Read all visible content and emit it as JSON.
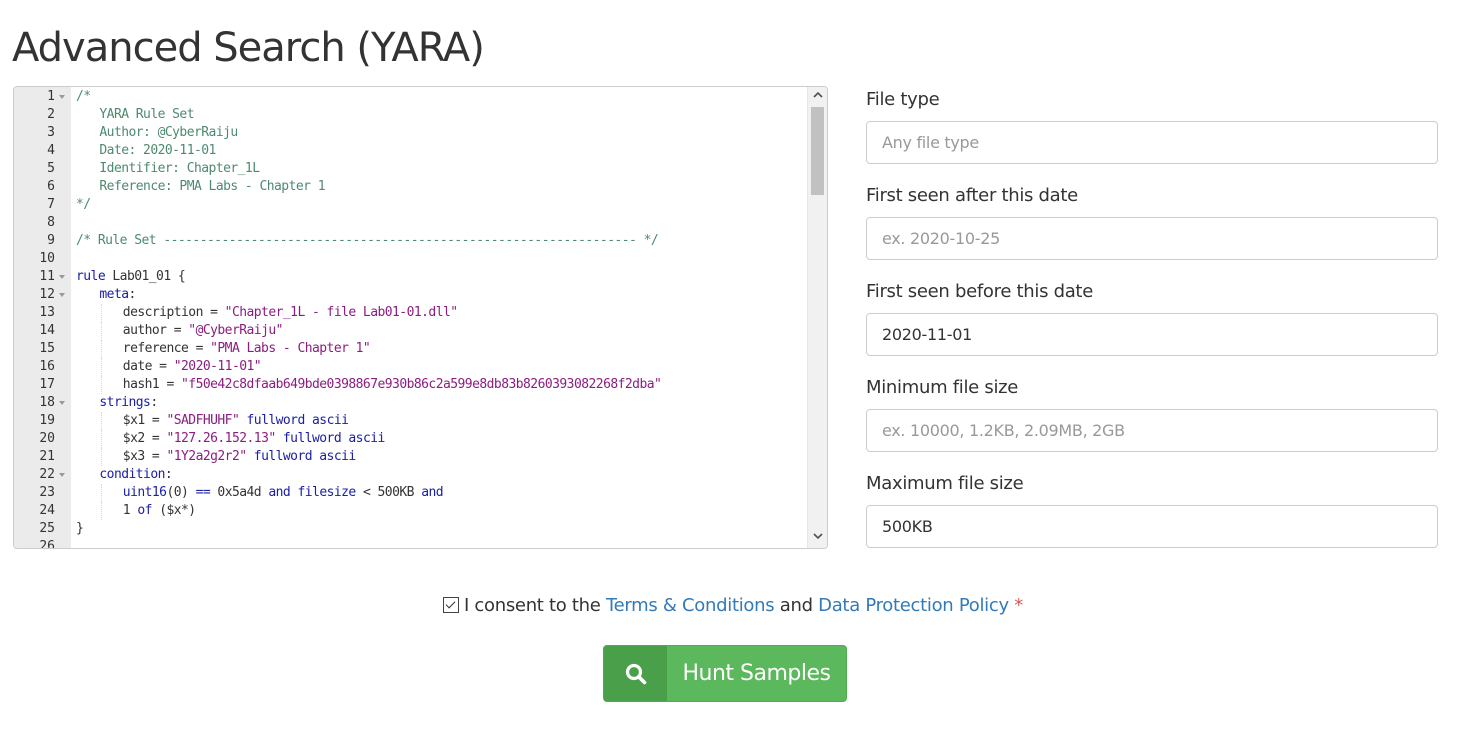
{
  "page": {
    "title": "Advanced Search (YARA)"
  },
  "editor": {
    "lines": [
      {
        "n": "1",
        "fold": true,
        "indent": 0,
        "tokens": [
          {
            "t": "/*",
            "c": "comment"
          }
        ]
      },
      {
        "n": "2",
        "fold": false,
        "indent": 1,
        "tokens": [
          {
            "t": "YARA Rule Set",
            "c": "comment"
          }
        ]
      },
      {
        "n": "3",
        "fold": false,
        "indent": 1,
        "tokens": [
          {
            "t": "Author: @CyberRaiju",
            "c": "comment"
          }
        ]
      },
      {
        "n": "4",
        "fold": false,
        "indent": 1,
        "tokens": [
          {
            "t": "Date: 2020-11-01",
            "c": "comment"
          }
        ]
      },
      {
        "n": "5",
        "fold": false,
        "indent": 1,
        "tokens": [
          {
            "t": "Identifier: Chapter_1L",
            "c": "comment"
          }
        ]
      },
      {
        "n": "6",
        "fold": false,
        "indent": 1,
        "tokens": [
          {
            "t": "Reference: PMA Labs - Chapter 1",
            "c": "comment"
          }
        ]
      },
      {
        "n": "7",
        "fold": false,
        "indent": 0,
        "tokens": [
          {
            "t": "*/",
            "c": "comment"
          }
        ]
      },
      {
        "n": "8",
        "fold": false,
        "indent": 0,
        "tokens": []
      },
      {
        "n": "9",
        "fold": false,
        "indent": 0,
        "tokens": [
          {
            "t": "/* Rule Set ----------------------------------------------------------------- */",
            "c": "comment"
          }
        ]
      },
      {
        "n": "10",
        "fold": false,
        "indent": 0,
        "tokens": []
      },
      {
        "n": "11",
        "fold": true,
        "indent": 0,
        "tokens": [
          {
            "t": "rule",
            "c": "kw"
          },
          {
            "t": " Lab01_01 {",
            "c": "plain"
          }
        ]
      },
      {
        "n": "12",
        "fold": true,
        "indent": 1,
        "tokens": [
          {
            "t": "meta",
            "c": "kw"
          },
          {
            "t": ":",
            "c": "plain"
          }
        ]
      },
      {
        "n": "13",
        "fold": false,
        "indent": 2,
        "tokens": [
          {
            "t": "description = ",
            "c": "plain"
          },
          {
            "t": "\"Chapter_1L - file Lab01-01.dll\"",
            "c": "str"
          }
        ]
      },
      {
        "n": "14",
        "fold": false,
        "indent": 2,
        "tokens": [
          {
            "t": "author = ",
            "c": "plain"
          },
          {
            "t": "\"@CyberRaiju\"",
            "c": "str"
          }
        ]
      },
      {
        "n": "15",
        "fold": false,
        "indent": 2,
        "tokens": [
          {
            "t": "reference = ",
            "c": "plain"
          },
          {
            "t": "\"PMA Labs - Chapter 1\"",
            "c": "str"
          }
        ]
      },
      {
        "n": "16",
        "fold": false,
        "indent": 2,
        "tokens": [
          {
            "t": "date = ",
            "c": "plain"
          },
          {
            "t": "\"2020-11-01\"",
            "c": "str"
          }
        ]
      },
      {
        "n": "17",
        "fold": false,
        "indent": 2,
        "tokens": [
          {
            "t": "hash1 = ",
            "c": "plain"
          },
          {
            "t": "\"f50e42c8dfaab649bde0398867e930b86c2a599e8db83b8260393082268f2dba\"",
            "c": "str"
          }
        ]
      },
      {
        "n": "18",
        "fold": true,
        "indent": 1,
        "tokens": [
          {
            "t": "strings",
            "c": "kw"
          },
          {
            "t": ":",
            "c": "plain"
          }
        ]
      },
      {
        "n": "19",
        "fold": false,
        "indent": 2,
        "tokens": [
          {
            "t": "$x1 = ",
            "c": "plain"
          },
          {
            "t": "\"SADFHUHF\"",
            "c": "str"
          },
          {
            "t": " fullword ascii",
            "c": "kw"
          }
        ]
      },
      {
        "n": "20",
        "fold": false,
        "indent": 2,
        "tokens": [
          {
            "t": "$x2 = ",
            "c": "plain"
          },
          {
            "t": "\"127.26.152.13\"",
            "c": "str"
          },
          {
            "t": " fullword ascii",
            "c": "kw"
          }
        ]
      },
      {
        "n": "21",
        "fold": false,
        "indent": 2,
        "tokens": [
          {
            "t": "$x3 = ",
            "c": "plain"
          },
          {
            "t": "\"1Y2a2g2r2\"",
            "c": "str"
          },
          {
            "t": " fullword ascii",
            "c": "kw"
          }
        ]
      },
      {
        "n": "22",
        "fold": true,
        "indent": 1,
        "tokens": [
          {
            "t": "condition",
            "c": "kw"
          },
          {
            "t": ":",
            "c": "plain"
          }
        ]
      },
      {
        "n": "23",
        "fold": false,
        "indent": 2,
        "tokens": [
          {
            "t": "uint16",
            "c": "kw"
          },
          {
            "t": "(0) ",
            "c": "plain"
          },
          {
            "t": "==",
            "c": "op"
          },
          {
            "t": " 0x5a4d ",
            "c": "plain"
          },
          {
            "t": "and",
            "c": "kw"
          },
          {
            "t": " ",
            "c": "plain"
          },
          {
            "t": "filesize",
            "c": "kw"
          },
          {
            "t": " < 500KB ",
            "c": "plain"
          },
          {
            "t": "and",
            "c": "kw"
          }
        ]
      },
      {
        "n": "24",
        "fold": false,
        "indent": 2,
        "tokens": [
          {
            "t": "1 ",
            "c": "plain"
          },
          {
            "t": "of",
            "c": "kw"
          },
          {
            "t": " ($x*)",
            "c": "plain"
          }
        ]
      },
      {
        "n": "25",
        "fold": false,
        "indent": 0,
        "tokens": [
          {
            "t": "}",
            "c": "plain"
          }
        ]
      },
      {
        "n": "26",
        "fold": false,
        "indent": 0,
        "tokens": []
      }
    ],
    "scroll_up_icon": "chevron-up-icon",
    "scroll_down_icon": "chevron-down-icon"
  },
  "form": {
    "file_type": {
      "label": "File type",
      "value": "",
      "placeholder": "Any file type"
    },
    "first_seen_after": {
      "label": "First seen after this date",
      "value": "",
      "placeholder": "ex. 2020-10-25"
    },
    "first_seen_before": {
      "label": "First seen before this date",
      "value": "2020-11-01",
      "placeholder": ""
    },
    "min_size": {
      "label": "Minimum file size",
      "value": "",
      "placeholder": "ex. 10000, 1.2KB, 2.09MB, 2GB"
    },
    "max_size": {
      "label": "Maximum file size",
      "value": "500KB",
      "placeholder": ""
    }
  },
  "consent": {
    "checked": true,
    "prefix": "I consent to the",
    "terms_link": "Terms & Conditions",
    "middle": "and",
    "policy_link": "Data Protection Policy",
    "required_mark": "*"
  },
  "submit": {
    "label": "Hunt Samples",
    "icon": "search-icon",
    "color": "#5cb85c"
  }
}
